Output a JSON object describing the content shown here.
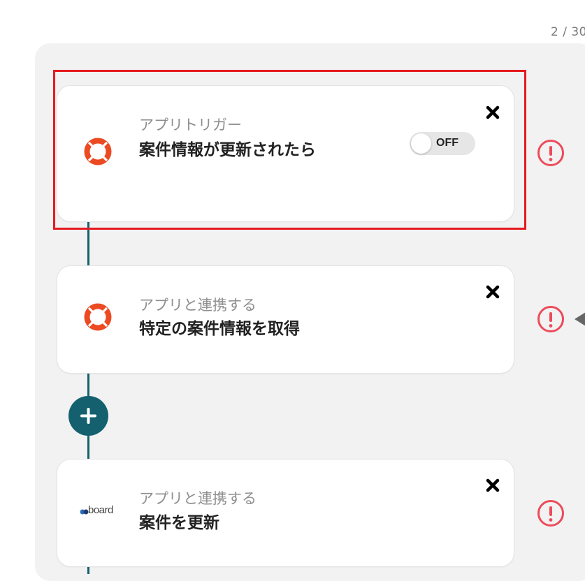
{
  "header": {
    "page_counter": "2 / 30"
  },
  "steps": [
    {
      "kind": "アプリトリガー",
      "title": "案件情報が更新されたら",
      "toggle_label": "OFF"
    },
    {
      "kind": "アプリと連携する",
      "title": "特定の案件情報を取得"
    },
    {
      "kind": "アプリと連携する",
      "title": "案件を更新",
      "logo_text": "board"
    }
  ],
  "colors": {
    "accent": "#14606e",
    "alert": "#ec4b5a",
    "highlight": "#e51a1f",
    "app_icon": "#ec4a22"
  },
  "icons": {
    "close": "close-icon",
    "alert": "alert-icon",
    "add": "plus-icon",
    "app": "lifebuoy-icon"
  }
}
